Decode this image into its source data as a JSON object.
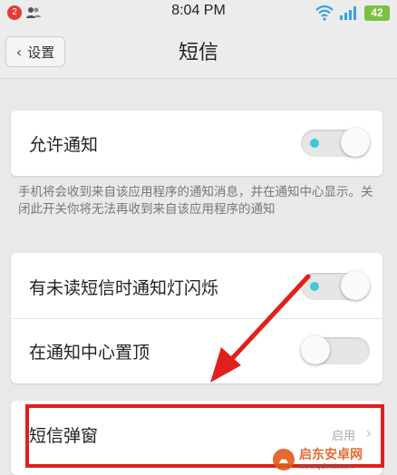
{
  "status_bar": {
    "notification_count": "2",
    "time": "8:04 PM",
    "battery": "42",
    "battery_color": "#7ac143"
  },
  "header": {
    "back_label": "设置",
    "title": "短信"
  },
  "settings": {
    "allow_notifications": {
      "label": "允许通知",
      "enabled": true
    },
    "notification_description": "手机将会收到来自该应用程序的通知消息，并在通知中心显示。关闭此开关你将无法再收到来自该应用程序的通知",
    "led_blink": {
      "label": "有未读短信时通知灯闪烁",
      "enabled": true
    },
    "pin_top": {
      "label": "在通知中心置顶",
      "enabled": false
    },
    "sms_popup": {
      "label": "短信弹窗",
      "value": "启用"
    }
  },
  "annotation": {
    "highlight_color": "#e0201c"
  },
  "watermark": {
    "main": "启东安卓网",
    "sub": "www.qdlmdt.com"
  },
  "colors": {
    "toggle_dot": "#3ec9d6",
    "background": "#ececec"
  }
}
